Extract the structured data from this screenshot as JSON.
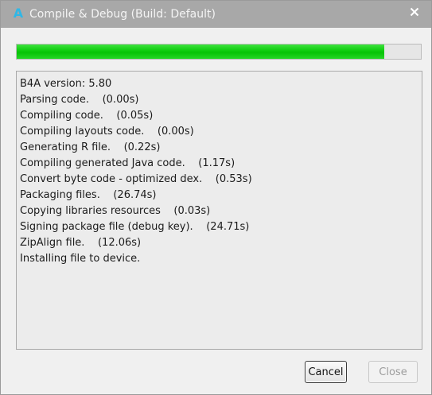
{
  "window": {
    "title": "Compile & Debug (Build: Default)",
    "app_icon_glyph": "A",
    "accent_color": "#2fb7e6"
  },
  "progress": {
    "value_percent": 91,
    "fill_color": "#0ccb0c"
  },
  "log": {
    "lines": [
      "B4A version: 5.80",
      "Parsing code.    (0.00s)",
      "Compiling code.    (0.05s)",
      "Compiling layouts code.    (0.00s)",
      "Generating R file.    (0.22s)",
      "Compiling generated Java code.    (1.17s)",
      "Convert byte code - optimized dex.    (0.53s)",
      "Packaging files.    (26.74s)",
      "Copying libraries resources    (0.03s)",
      "Signing package file (debug key).    (24.71s)",
      "ZipAlign file.    (12.06s)",
      "Installing file to device."
    ]
  },
  "buttons": {
    "cancel_label": "Cancel",
    "close_label": "Close",
    "close_enabled": false
  },
  "icons": {
    "app": "b4a-logo-icon",
    "close": "close-icon"
  }
}
